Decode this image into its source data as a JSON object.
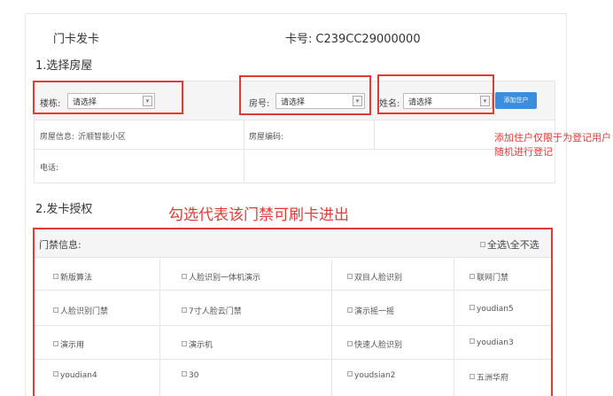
{
  "header": {
    "title": "门卡发卡",
    "card_label": "卡号:",
    "card_value": "C239CC29000000"
  },
  "section1": {
    "title": "1.选择房屋"
  },
  "form": {
    "building_label": "楼栋:",
    "building_value": "请选择",
    "room_label": "房号:",
    "room_value": "请选择",
    "name_label": "姓名:",
    "name_value": "请选择",
    "add_button": "添加住户"
  },
  "house_info": {
    "info_label": "房屋信息:",
    "info_value": "沂顺智能小区",
    "code_label": "房屋编码:",
    "phone_label": "电话:"
  },
  "annotations": {
    "add_note": "添加住户仅限于为登记用户随机进行登记",
    "check_note": "勾选代表该门禁可刷卡进出"
  },
  "section2": {
    "title": "2.发卡授权"
  },
  "access": {
    "header_title": "门禁信息:",
    "select_all": "全选\\全不选",
    "rows": [
      [
        "新版算法",
        "人脸识别一体机演示",
        "双目人脸识别",
        "联网门禁"
      ],
      [
        "人脸识别门禁",
        "7寸人脸云门禁",
        "演示摇一摇",
        "youdian5"
      ],
      [
        "演示用",
        "演示机",
        "快速人脸识别",
        "youdian3"
      ],
      [
        "youdian4",
        "30",
        "youdsian2",
        "五洲华府"
      ]
    ]
  },
  "colors": {
    "accent": "#3c8dde",
    "annotation_red": "#e53935"
  }
}
